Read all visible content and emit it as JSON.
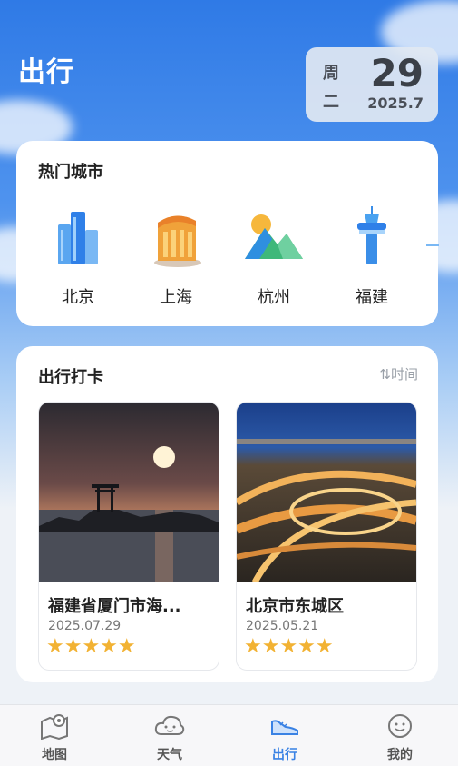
{
  "header": {
    "title": "出行"
  },
  "date": {
    "weekday_a": "周",
    "weekday_b": "二",
    "day": "29",
    "year_month": "2025.7"
  },
  "hot_cities": {
    "title": "热门城市",
    "items": [
      {
        "name": "北京",
        "icon": "beijing-buildings-icon"
      },
      {
        "name": "上海",
        "icon": "shanghai-building-icon"
      },
      {
        "name": "杭州",
        "icon": "hangzhou-mountain-icon"
      },
      {
        "name": "福建",
        "icon": "fujian-tower-icon"
      }
    ]
  },
  "checkins": {
    "title": "出行打卡",
    "sort_label": "时间",
    "posts": [
      {
        "title": "福建省厦门市海...",
        "date": "2025.07.29",
        "rating": 5,
        "photo": "sunset-torii-sea-photo"
      },
      {
        "title": "北京市东城区",
        "date": "2025.05.21",
        "rating": 5,
        "photo": "city-interchange-night-photo"
      }
    ]
  },
  "tabbar": {
    "active": "出行",
    "items": [
      {
        "label": "地图",
        "icon": "map-pin-icon"
      },
      {
        "label": "天气",
        "icon": "cloud-face-icon"
      },
      {
        "label": "出行",
        "icon": "sneaker-icon"
      },
      {
        "label": "我的",
        "icon": "smile-face-icon"
      }
    ]
  },
  "colors": {
    "accent": "#3a82e4",
    "star": "#f2b233",
    "sky": "#2f7ae6"
  }
}
